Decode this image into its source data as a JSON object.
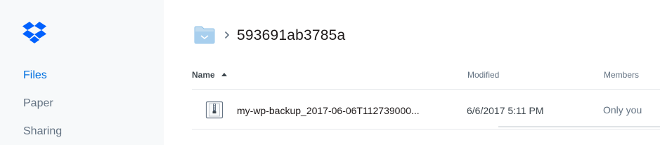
{
  "sidebar": {
    "logo_icon": "dropbox-logo-icon",
    "items": [
      {
        "label": "Files",
        "active": true
      },
      {
        "label": "Paper",
        "active": false
      },
      {
        "label": "Sharing",
        "active": false
      }
    ]
  },
  "header": {
    "folder_icon": "folder-icon",
    "chevron_icon": "chevron-right-icon",
    "title": "593691ab3785a"
  },
  "table": {
    "columns": {
      "name": "Name",
      "modified": "Modified",
      "members": "Members"
    },
    "sort_icon": "sort-ascending-icon",
    "rows": [
      {
        "icon": "zip-file-icon",
        "name": "my-wp-backup_2017-06-06T112739000...",
        "modified": "6/6/2017 5:11 PM",
        "members": "Only you"
      }
    ]
  },
  "colors": {
    "accent": "#0070e0",
    "brand": "#0061fe",
    "sidebar_bg": "#f7f9fa",
    "folder": "#8fc2e8",
    "muted_text": "#637282"
  }
}
